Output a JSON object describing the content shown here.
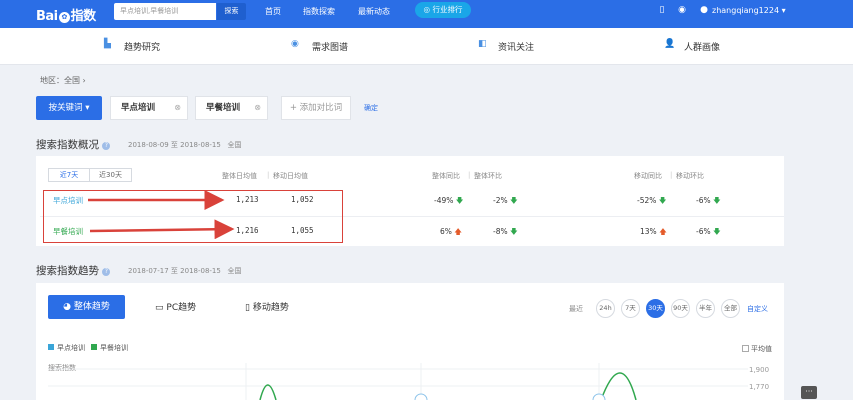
{
  "brand": {
    "logo_left": "Bai",
    "logo_right": "指数",
    "paw": "✿"
  },
  "search": {
    "value": "早点培训,早餐培训",
    "button": "探索"
  },
  "nav": [
    "首页",
    "指数探索",
    "最新动态"
  ],
  "industry_button": "◎ 行业排行",
  "user": {
    "name": "zhangqiang1224",
    "caret": "▾"
  },
  "subnav": [
    {
      "label": "趋势研究",
      "icon": "bar-chart-icon"
    },
    {
      "label": "需求图谱",
      "icon": "demand-map-icon"
    },
    {
      "label": "资讯关注",
      "icon": "news-icon"
    },
    {
      "label": "人群画像",
      "icon": "people-icon"
    }
  ],
  "breadcrumb": "地区：全国 ›",
  "keyword_bar": {
    "mode_button": "按关键词 ▾",
    "keywords": [
      "早点培训",
      "早餐培训"
    ],
    "remove": "⊗",
    "add": "+ 添加对比词",
    "confirm": "确定"
  },
  "overview": {
    "title": "搜索指数概况",
    "date_from": "2018-08-09",
    "date_to": "2018-08-15",
    "date_sep": "至",
    "region": "全国",
    "tabs": [
      "近7天",
      "近30天"
    ],
    "headers": {
      "overall_avg": "整体日均值",
      "mobile_avg": "移动日均值",
      "overall_yoy": "整体同比",
      "overall_mom": "整体环比",
      "mobile_yoy": "移动同比",
      "mobile_mom": "移动环比",
      "sep": "|"
    },
    "rows": [
      {
        "keyword": "早点培训",
        "color": "#3aa5d8",
        "overall_avg": "1,213",
        "mobile_avg": "1,052",
        "overall_yoy": "-49%",
        "overall_yoy_dir": "down",
        "overall_mom": "-2%",
        "overall_mom_dir": "down",
        "mobile_yoy": "-52%",
        "mobile_yoy_dir": "down",
        "mobile_mom": "-6%",
        "mobile_mom_dir": "down"
      },
      {
        "keyword": "早餐培训",
        "color": "#31a84f",
        "overall_avg": "1,216",
        "mobile_avg": "1,055",
        "overall_yoy": "6%",
        "overall_yoy_dir": "up",
        "overall_mom": "-8%",
        "overall_mom_dir": "down",
        "mobile_yoy": "13%",
        "mobile_yoy_dir": "up",
        "mobile_mom": "-6%",
        "mobile_mom_dir": "down"
      }
    ]
  },
  "trend": {
    "title": "搜索指数趋势",
    "date_from": "2018-07-17",
    "date_to": "2018-08-15",
    "date_sep": "至",
    "region": "全国",
    "tabs": [
      "整体趋势",
      "PC趋势",
      "移动趋势"
    ],
    "range_label": "最近",
    "ranges": [
      "24h",
      "7天",
      "30天",
      "90天",
      "半年",
      "全部"
    ],
    "active_range": "30天",
    "custom": "自定义",
    "legend": [
      {
        "name": "早点培训",
        "color": "#3aa5d8"
      },
      {
        "name": "早餐培训",
        "color": "#31a84f"
      }
    ],
    "average_toggle": "平均值",
    "y_label": "搜索指数",
    "y_ticks": [
      "1,900",
      "1,770"
    ]
  },
  "chat_icon": "chat-icon"
}
